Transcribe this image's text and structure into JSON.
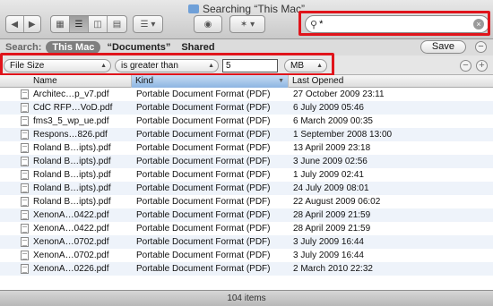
{
  "window": {
    "title": "Searching “This Mac”"
  },
  "toolbar": {
    "back_label": "◀",
    "forward_label": "▶",
    "view_icons": [
      "icon-view-icon",
      "list-view-icon",
      "column-view-icon",
      "coverflow-view-icon"
    ],
    "arrange_label": "☰ ▾",
    "quicklook_label": "◉",
    "action_label": "✶ ▾"
  },
  "search": {
    "value": "*",
    "clear_label": "×"
  },
  "scope": {
    "label": "Search:",
    "this_mac": "This Mac",
    "documents": "“Documents”",
    "shared": "Shared",
    "save_label": "Save",
    "remove_label": "−"
  },
  "criteria": {
    "attribute": "File Size",
    "operator": "is greater than",
    "value": "5",
    "unit": "MB",
    "remove_label": "−",
    "add_label": "+"
  },
  "columns": {
    "name": "Name",
    "kind": "Kind",
    "last_opened": "Last Opened"
  },
  "files": [
    {
      "name": "Architec…p_v7.pdf",
      "kind": "Portable Document Format (PDF)",
      "last_opened": "27 October 2009 23:11"
    },
    {
      "name": "CdC RFP…VoD.pdf",
      "kind": "Portable Document Format (PDF)",
      "last_opened": "6 July 2009 05:46"
    },
    {
      "name": "fms3_5_wp_ue.pdf",
      "kind": "Portable Document Format (PDF)",
      "last_opened": "6 March 2009 00:35"
    },
    {
      "name": "Respons…826.pdf",
      "kind": "Portable Document Format (PDF)",
      "last_opened": "1 September 2008 13:00"
    },
    {
      "name": "Roland B…ipts).pdf",
      "kind": "Portable Document Format (PDF)",
      "last_opened": "13 April 2009 23:18"
    },
    {
      "name": "Roland B…ipts).pdf",
      "kind": "Portable Document Format (PDF)",
      "last_opened": "3 June 2009 02:56"
    },
    {
      "name": "Roland B…ipts).pdf",
      "kind": "Portable Document Format (PDF)",
      "last_opened": "1 July 2009 02:41"
    },
    {
      "name": "Roland B…ipts).pdf",
      "kind": "Portable Document Format (PDF)",
      "last_opened": "24 July 2009 08:01"
    },
    {
      "name": "Roland B…ipts).pdf",
      "kind": "Portable Document Format (PDF)",
      "last_opened": "22 August 2009 06:02"
    },
    {
      "name": "XenonA…0422.pdf",
      "kind": "Portable Document Format (PDF)",
      "last_opened": "28 April 2009 21:59"
    },
    {
      "name": "XenonA…0422.pdf",
      "kind": "Portable Document Format (PDF)",
      "last_opened": "28 April 2009 21:59"
    },
    {
      "name": "XenonA…0702.pdf",
      "kind": "Portable Document Format (PDF)",
      "last_opened": "3 July 2009 16:44"
    },
    {
      "name": "XenonA…0702.pdf",
      "kind": "Portable Document Format (PDF)",
      "last_opened": "3 July 2009 16:44"
    },
    {
      "name": "XenonA…0226.pdf",
      "kind": "Portable Document Format (PDF)",
      "last_opened": "2 March 2010 22:32"
    }
  ],
  "status": {
    "item_count": "104 items"
  },
  "colors": {
    "highlight": "#e0141b",
    "kind_header": "#8db5e2",
    "row_alt": "#eef3fa"
  }
}
